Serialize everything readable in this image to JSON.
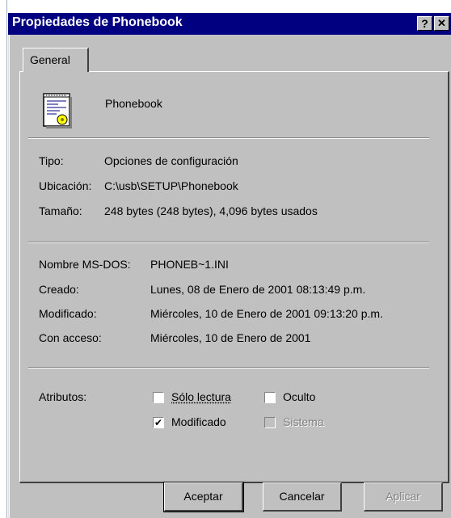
{
  "window": {
    "title": "Propiedades de Phonebook",
    "help_button": "?",
    "close_button": "✕"
  },
  "tabs": [
    {
      "label": "General"
    }
  ],
  "file": {
    "icon": "config-file-icon",
    "name": "Phonebook"
  },
  "info": [
    {
      "label": "Tipo:",
      "value": "Opciones de configuración"
    },
    {
      "label": "Ubicación:",
      "value": "C:\\usb\\SETUP\\Phonebook"
    },
    {
      "label": "Tamaño:",
      "value": "248 bytes (248 bytes), 4,096 bytes usados"
    }
  ],
  "dates": [
    {
      "label": "Nombre MS-DOS:",
      "value": "PHONEB~1.INI"
    },
    {
      "label": "Creado:",
      "value": "Lunes, 08 de Enero de 2001 08:13:49 p.m."
    },
    {
      "label": "Modificado:",
      "value": "Miércoles, 10 de Enero de 2001 09:13:20 p.m."
    },
    {
      "label": "Con acceso:",
      "value": "Miércoles, 10 de Enero de 2001"
    }
  ],
  "attributes": {
    "label": "Atributos:",
    "items": [
      {
        "label": "Sólo lectura",
        "checked": false,
        "enabled": true
      },
      {
        "label": "Oculto",
        "checked": false,
        "enabled": true
      },
      {
        "label": "Modificado",
        "checked": true,
        "enabled": true
      },
      {
        "label": "Sistema",
        "checked": false,
        "enabled": false
      }
    ]
  },
  "buttons": {
    "ok": "Aceptar",
    "cancel": "Cancelar",
    "apply": "Aplicar"
  },
  "colors": {
    "titlebar": "#000080",
    "face": "#c0c0c0"
  }
}
